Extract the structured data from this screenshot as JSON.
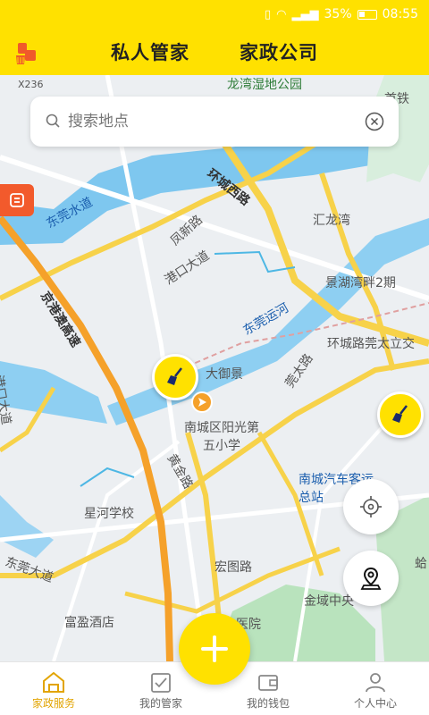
{
  "status_bar": {
    "battery": "35%",
    "time": "08:55",
    "network": "4G"
  },
  "header": {
    "tabs": [
      "私人管家",
      "家政公司"
    ]
  },
  "search": {
    "placeholder": "搜索地点"
  },
  "map": {
    "labels": {
      "x236": "X236",
      "longwan": "龙湾湿地公园",
      "huancheng_west": "环城西路",
      "huilong_bay": "汇龙湾",
      "dongguan_water": "东莞水道",
      "fenghe_road": "凤新路",
      "gangkou": "港口大道",
      "jinggang": "京港澳高速",
      "dongguan_canal": "东莞运河",
      "jinghu": "景湖湾畔2期",
      "huancheng_wan": "环城路莞太立交",
      "dayujing": "大御景",
      "school": "南城区阳光第五小学",
      "huangjin": "黄金路",
      "bus_station": "南城汽车客运总站",
      "xinghe_school": "星河学校",
      "dongguan_avenue": "东莞大道",
      "fuying_hotel": "富盈酒店",
      "hongtu": "宏图路",
      "jinyu": "金域中央",
      "hospital": "医院",
      "guantai": "莞太路",
      "gangkou_left": "港口大道",
      "shouyi": "首铁",
      "ge": "蛤"
    }
  },
  "bottom_nav": {
    "items": [
      {
        "label": "家政服务"
      },
      {
        "label": "我的管家"
      },
      {
        "label": "我的钱包"
      },
      {
        "label": "个人中心"
      }
    ]
  },
  "colors": {
    "accent": "#ffe100",
    "active": "#e2a400",
    "highway": "#f5a12a"
  }
}
